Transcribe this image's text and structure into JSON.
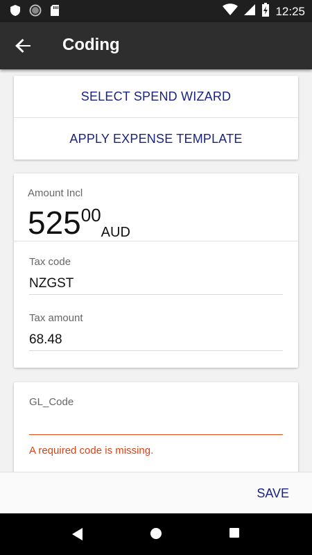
{
  "status_bar": {
    "time": "12:25",
    "icons": [
      "shield-icon",
      "circle-icon",
      "sd-card-icon",
      "wifi-icon",
      "signal-icon",
      "battery-charging-icon"
    ]
  },
  "app_bar": {
    "title": "Coding",
    "back_icon": "arrow-left-icon"
  },
  "actions": {
    "select_spend_wizard": "SELECT SPEND WIZARD",
    "apply_expense_template": "APPLY EXPENSE TEMPLATE"
  },
  "amount": {
    "label": "Amount Incl",
    "main": "525",
    "cents": "00",
    "currency": "AUD"
  },
  "tax_code": {
    "label": "Tax code",
    "value": "NZGST"
  },
  "tax_amount": {
    "label": "Tax amount",
    "value": "68.48"
  },
  "gl_code": {
    "label": "GL_Code",
    "value": "",
    "error": "A required code is missing."
  },
  "bottom_bar": {
    "save_label": "SAVE"
  },
  "nav_bar": {
    "icons": [
      "back-triangle-icon",
      "home-circle-icon",
      "recents-square-icon"
    ]
  },
  "colors": {
    "accent": "#1a237e",
    "error": "#d84315",
    "app_bar": "#2e2e2e",
    "status_bar": "#1f1f1f"
  }
}
